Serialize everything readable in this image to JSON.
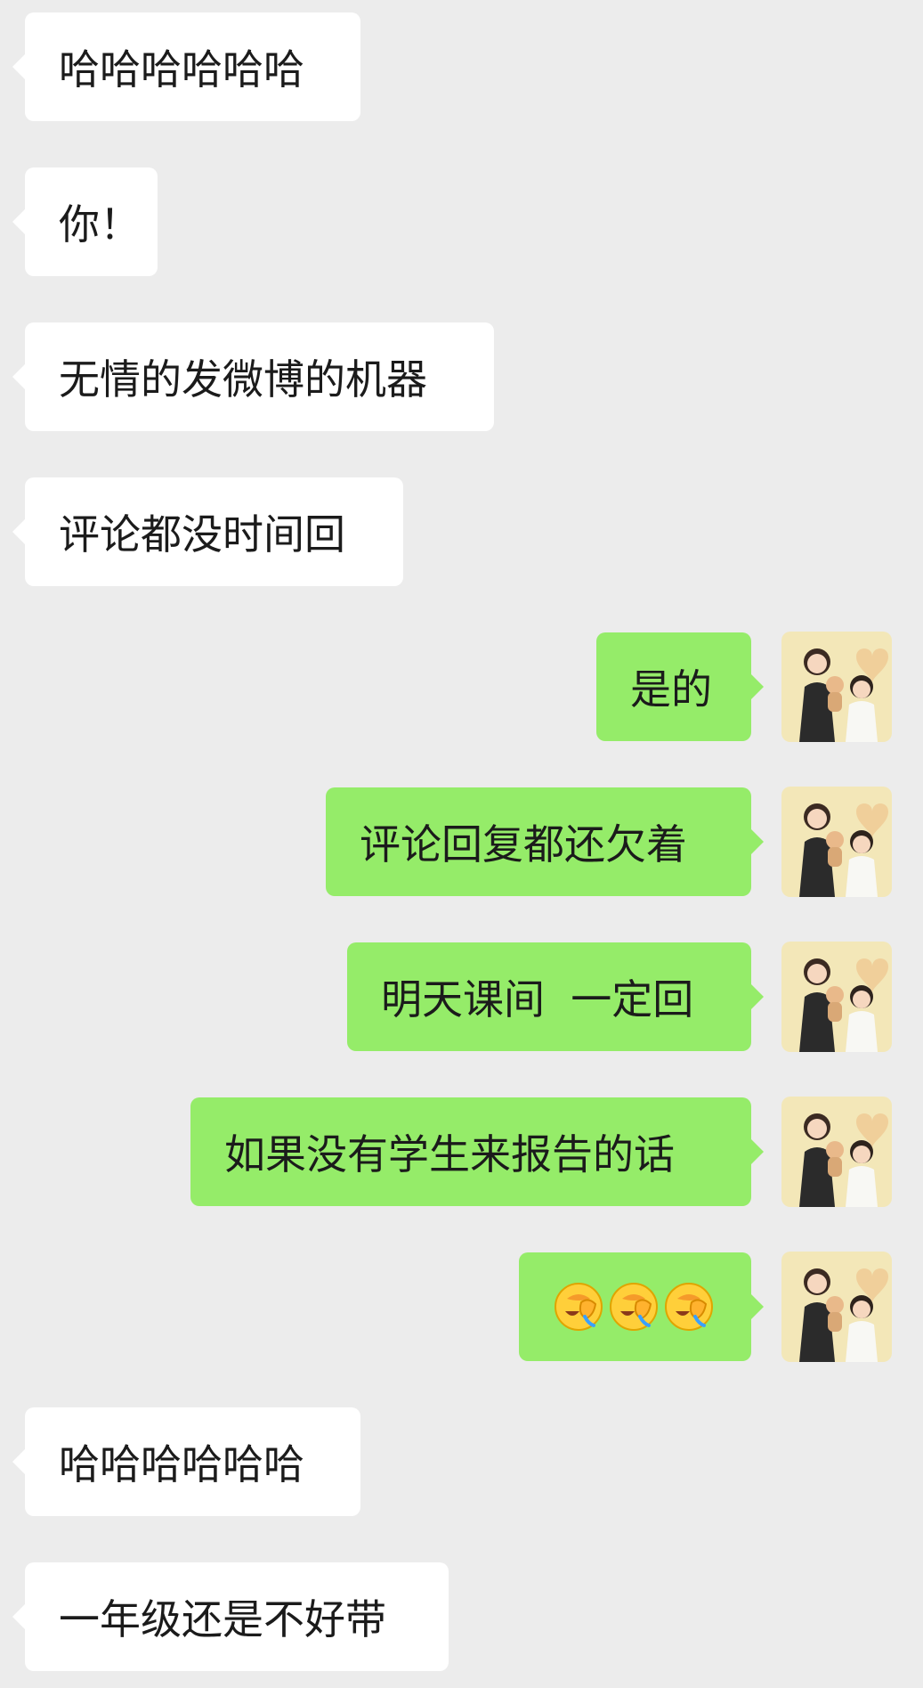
{
  "messages": [
    {
      "side": "in",
      "text": "哈哈哈哈哈哈"
    },
    {
      "side": "in",
      "text": "你！"
    },
    {
      "side": "in",
      "text": "无情的发微博的机器"
    },
    {
      "side": "in",
      "text": "评论都没时间回"
    },
    {
      "side": "out",
      "text": "是的"
    },
    {
      "side": "out",
      "text": "评论回复都还欠着"
    },
    {
      "side": "out",
      "text": "明天课间  一定回"
    },
    {
      "side": "out",
      "text": "如果没有学生来报告的话"
    },
    {
      "side": "out",
      "emoji": [
        "facepalm-emoji",
        "facepalm-emoji",
        "facepalm-emoji"
      ]
    },
    {
      "side": "in",
      "text": "哈哈哈哈哈哈"
    },
    {
      "side": "in",
      "text": "一年级还是不好带"
    }
  ],
  "colors": {
    "background": "#ececec",
    "incoming_bubble": "#ffffff",
    "outgoing_bubble": "#95ec69",
    "text": "#1b1b1b"
  }
}
